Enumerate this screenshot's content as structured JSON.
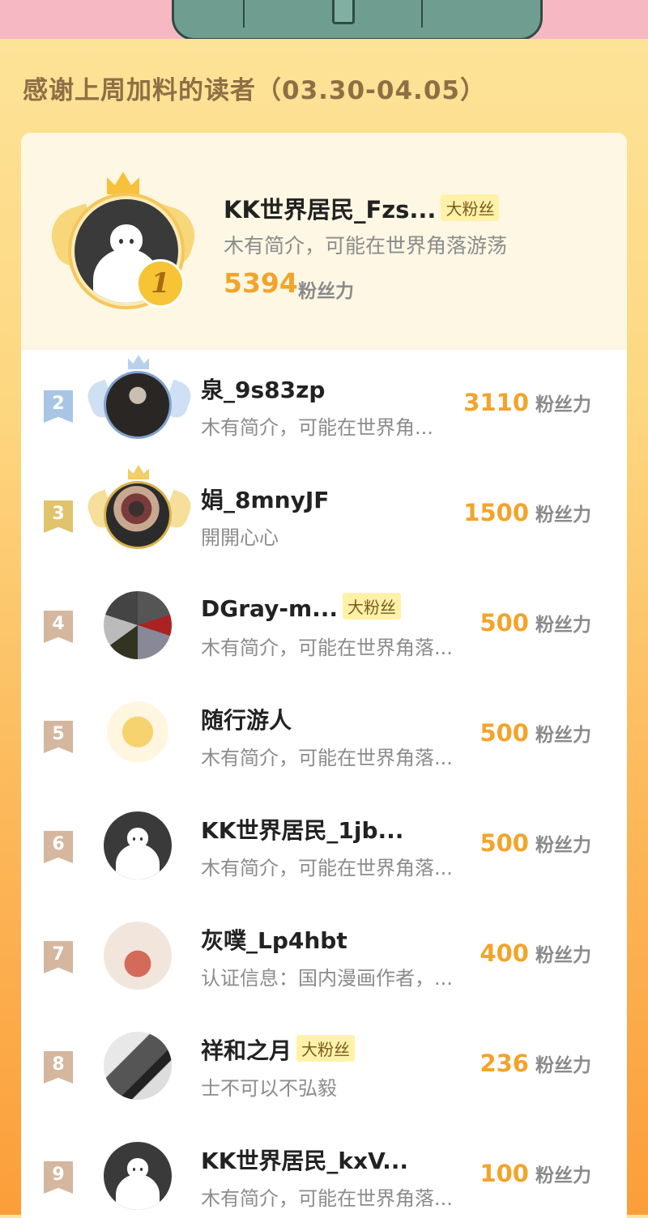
{
  "heading": "感谢上周加料的读者（03.30-04.05）",
  "colors": {
    "accent": "#f2a42a",
    "badge_bg": "#fff2a8"
  },
  "top_fan": {
    "rank": "1",
    "name": "KK世界居民_Fzs...",
    "badge": "大粉丝",
    "bio": "木有简介，可能在世界角落游荡",
    "score": "5394",
    "unit": "粉丝力"
  },
  "fans": [
    {
      "rank": "2",
      "name": "泉_9s83zp",
      "badge": "",
      "bio": "木有简介，可能在世界角...",
      "score": "3110",
      "unit": "粉丝力",
      "avatar": "photo-avatar"
    },
    {
      "rank": "3",
      "name": "娟_8mnyJF",
      "badge": "",
      "bio": "開開心心",
      "score": "1500",
      "unit": "粉丝力",
      "avatar": "photo-avatar"
    },
    {
      "rank": "4",
      "name": "DGray-m...",
      "badge": "大粉丝",
      "bio": "木有简介，可能在世界角落...",
      "score": "500",
      "unit": "粉丝力",
      "avatar": "mecha-avatar"
    },
    {
      "rank": "5",
      "name": "随行游人",
      "badge": "",
      "bio": "木有简介，可能在世界角落...",
      "score": "500",
      "unit": "粉丝力",
      "avatar": "anime-cat-avatar"
    },
    {
      "rank": "6",
      "name": "KK世界居民_1jb...",
      "badge": "",
      "bio": "木有简介，可能在世界角落...",
      "score": "500",
      "unit": "粉丝力",
      "avatar": "default-ghost-avatar"
    },
    {
      "rank": "7",
      "name": "灰噗_Lp4hbt",
      "badge": "",
      "bio": "认证信息：国内漫画作者，...",
      "score": "400",
      "unit": "粉丝力",
      "avatar": "elf-avatar"
    },
    {
      "rank": "8",
      "name": "祥和之月",
      "badge": "大粉丝",
      "bio": "士不可以不弘毅",
      "score": "236",
      "unit": "粉丝力",
      "avatar": "camera-avatar"
    },
    {
      "rank": "9",
      "name": "KK世界居民_kxV...",
      "badge": "",
      "bio": "木有简介，可能在世界角落...",
      "score": "100",
      "unit": "粉丝力",
      "avatar": "default-ghost-avatar"
    }
  ]
}
